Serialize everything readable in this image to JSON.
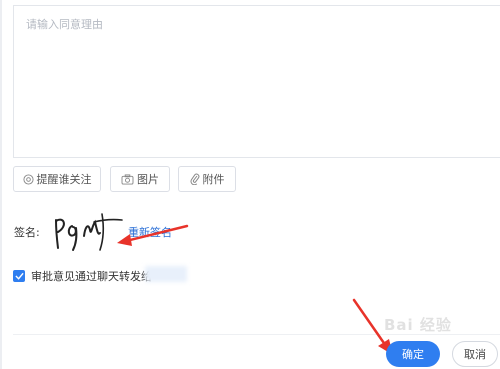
{
  "reason_input": {
    "placeholder": "请输入同意理由"
  },
  "toolbar": {
    "mention_label": "提醒谁关注",
    "image_label": "图片",
    "attachment_label": "附件"
  },
  "signature": {
    "label": "签名:",
    "resign_label": "重新签名"
  },
  "forward": {
    "checked": true,
    "label": "审批意见通过聊天转发给"
  },
  "footer": {
    "confirm_label": "确定",
    "cancel_label": "取消"
  },
  "watermark": {
    "text": "Bai 经验"
  },
  "colors": {
    "accent": "#2f7ef0",
    "link": "#2b6fd6",
    "arrow": "#e8332a"
  }
}
